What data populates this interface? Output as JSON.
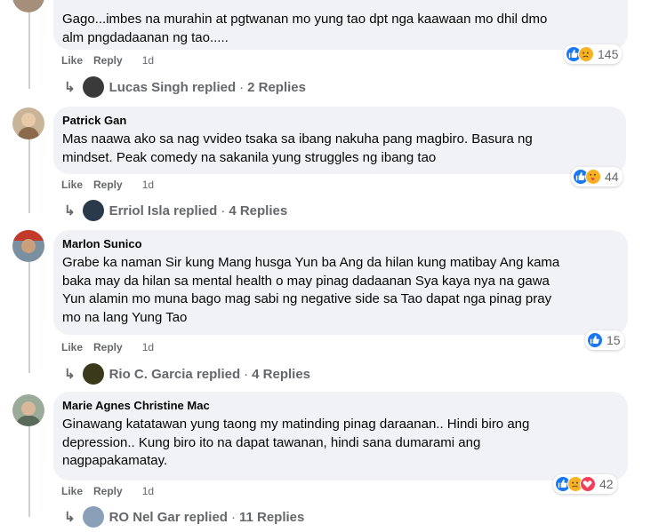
{
  "comments": [
    {
      "author": "",
      "text": "Gago...imbes na murahin at pgtwanan mo yung tao dpt nga kaawaan mo dhil dmo\nalm pngdadaanan ng tao.....",
      "like": "Like",
      "reply": "Reply",
      "time": "1d",
      "reaction_count": "145",
      "reactions": [
        "like-icon",
        "sad-icon"
      ],
      "replies": {
        "name": "Lucas Singh",
        "replied": "replied",
        "count": "2 Replies"
      }
    },
    {
      "author": "Patrick Gan",
      "text": "Mas naawa ako sa nag vvideo tsaka sa ibang nakuha pang magbiro. Basura ng\nmindset. Peak comedy na sakanila yung struggles ng ibang tao",
      "like": "Like",
      "reply": "Reply",
      "time": "1d",
      "reaction_count": "44",
      "reactions": [
        "like-icon",
        "care-icon"
      ],
      "replies": {
        "name": "Erriol Isla",
        "replied": "replied",
        "count": "4 Replies"
      }
    },
    {
      "author": "Marlon Sunico",
      "text": "Grabe ka naman Sir kung Mang husga Yun ba Ang da hilan kung matibay Ang kama\nbaka may da hilan sa mental health o may pinag dadaanan Sya kaya nya na gawa\nYun alamin mo muna bago mag sabi ng negative side sa Tao dapat nga pinag pray\nmo na lang Yung Tao",
      "like": "Like",
      "reply": "Reply",
      "time": "1d",
      "reaction_count": "15",
      "reactions": [
        "like-icon"
      ],
      "replies": {
        "name": "Rio C. Garcia",
        "replied": "replied",
        "count": "4 Replies"
      }
    },
    {
      "author": "Marie Agnes Christine Mac",
      "text": "Ginawang katatawan yung taong my matinding pinag daraanan.. Hindi biro ang\ndepression.. Kung biro ito na dapat tawanan, hindi sana dumarami ang\nnagpapakamatay.",
      "like": "Like",
      "reply": "Reply",
      "time": "1d",
      "reaction_count": "42",
      "reactions": [
        "like-icon",
        "sad-icon",
        "love-icon"
      ],
      "replies": {
        "name": "RO Nel Gar",
        "replied": "replied",
        "count": "11 Replies"
      }
    }
  ],
  "colors": {
    "bubble": "#f0f2f5",
    "like": "#1877f2",
    "love": "#f33e58",
    "sad": "#f7b125",
    "secondary_text": "#65676b"
  }
}
